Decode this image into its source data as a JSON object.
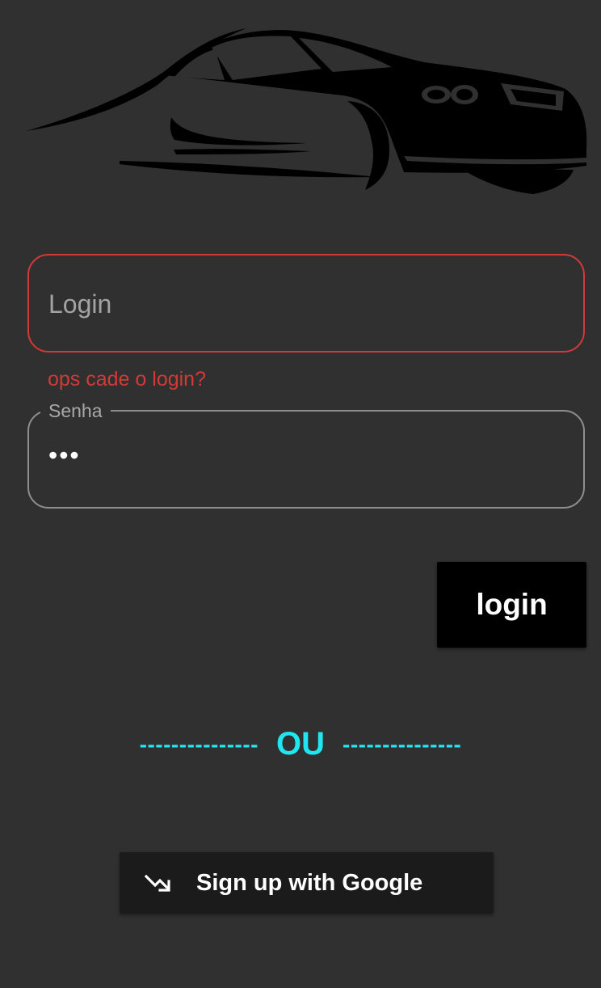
{
  "logo": {
    "icon": "car-silhouette-icon"
  },
  "login_field": {
    "placeholder": "Login",
    "value": "",
    "error": "ops cade o login?",
    "error_color": "#d23a35"
  },
  "password_field": {
    "label": "Senha",
    "value": "•••"
  },
  "login_button": {
    "label": "login"
  },
  "divider": {
    "left_dashes": "---------------",
    "text": "OU",
    "right_dashes": "---------------",
    "color": "#1fe6ef"
  },
  "google_button": {
    "label": "Sign up with Google",
    "icon": "trending-arrow-icon"
  },
  "colors": {
    "background": "#303030",
    "button": "#000000",
    "google_button": "#1b1b1b"
  }
}
